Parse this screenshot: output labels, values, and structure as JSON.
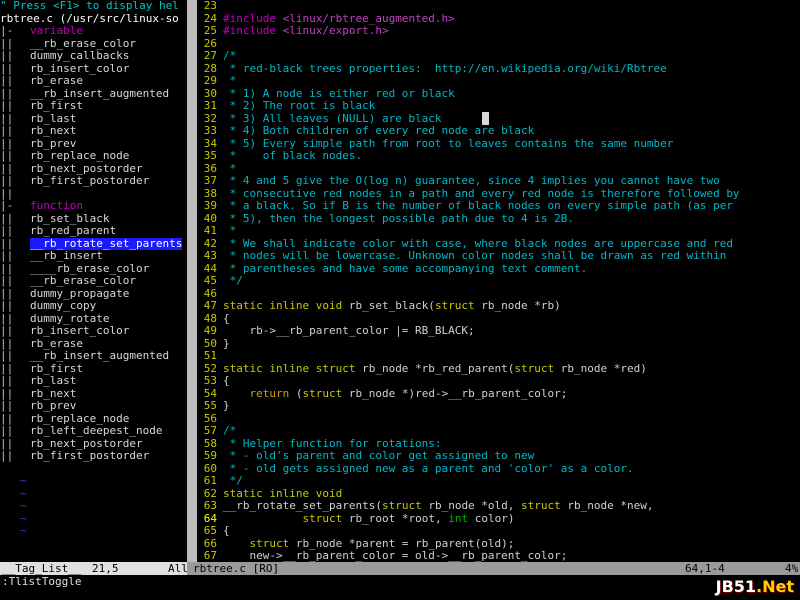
{
  "taglist": {
    "help_line": "\" Press <F1> to display hel",
    "file_line": "rbtree.c (/usr/src/linux-so",
    "groups": [
      {
        "fold": "|-",
        "type": "variable",
        "items": [
          "__rb_erase_color",
          "dummy_callbacks",
          "rb_insert_color",
          "rb_erase",
          "__rb_insert_augmented",
          "rb_first",
          "rb_last",
          "rb_next",
          "rb_prev",
          "rb_replace_node",
          "rb_next_postorder",
          "rb_first_postorder"
        ]
      },
      {
        "fold": "|-",
        "type": "function",
        "items": [
          "rb_set_black",
          "rb_red_parent",
          "__rb_rotate_set_parents",
          "__rb_insert",
          "____rb_erase_color",
          "__rb_erase_color",
          "dummy_propagate",
          "dummy_copy",
          "dummy_rotate",
          "rb_insert_color",
          "rb_erase",
          "__rb_insert_augmented",
          "rb_first",
          "rb_last",
          "rb_next",
          "rb_prev",
          "rb_replace_node",
          "rb_left_deepest_node",
          "rb_next_postorder",
          "rb_first_postorder"
        ]
      }
    ],
    "selected": "__rb_rotate_set_parents",
    "tilde": "~"
  },
  "editor": {
    "lines": [
      {
        "n": "23",
        "segs": [
          {
            "c": "code",
            "t": ""
          }
        ]
      },
      {
        "n": "24",
        "segs": [
          {
            "c": "pp",
            "t": "#include "
          },
          {
            "c": "str",
            "t": "<linux/rbtree_augmented.h>"
          }
        ]
      },
      {
        "n": "25",
        "segs": [
          {
            "c": "pp",
            "t": "#include "
          },
          {
            "c": "str",
            "t": "<linux/export.h>"
          }
        ]
      },
      {
        "n": "26",
        "segs": [
          {
            "c": "code",
            "t": ""
          }
        ]
      },
      {
        "n": "27",
        "segs": [
          {
            "c": "com",
            "t": "/*"
          }
        ]
      },
      {
        "n": "28",
        "segs": [
          {
            "c": "com",
            "t": " * red-black trees properties:  http://en.wikipedia.org/wiki/Rbtree"
          }
        ]
      },
      {
        "n": "29",
        "segs": [
          {
            "c": "com",
            "t": " *"
          }
        ]
      },
      {
        "n": "30",
        "segs": [
          {
            "c": "com",
            "t": " * 1) A node is either red or black"
          }
        ]
      },
      {
        "n": "31",
        "segs": [
          {
            "c": "com",
            "t": " * 2) The root is black"
          }
        ]
      },
      {
        "n": "32",
        "segs": [
          {
            "c": "com",
            "t": " * 3) All leaves (NULL) are black"
          }
        ]
      },
      {
        "n": "33",
        "segs": [
          {
            "c": "com",
            "t": " * 4) Both children of every red node are black"
          }
        ]
      },
      {
        "n": "34",
        "segs": [
          {
            "c": "com",
            "t": " * 5) Every simple path from root to leaves contains the same number"
          }
        ]
      },
      {
        "n": "35",
        "segs": [
          {
            "c": "com",
            "t": " *    of black nodes."
          }
        ]
      },
      {
        "n": "36",
        "segs": [
          {
            "c": "com",
            "t": " *"
          }
        ]
      },
      {
        "n": "37",
        "segs": [
          {
            "c": "com",
            "t": " * 4 and 5 give the O(log n) guarantee, since 4 implies you cannot have two"
          }
        ]
      },
      {
        "n": "38",
        "segs": [
          {
            "c": "com",
            "t": " * consecutive red nodes in a path and every red node is therefore followed by"
          }
        ]
      },
      {
        "n": "39",
        "segs": [
          {
            "c": "com",
            "t": " * a black. So if B is the number of black nodes on every simple path (as per"
          }
        ]
      },
      {
        "n": "40",
        "segs": [
          {
            "c": "com",
            "t": " * 5), then the longest possible path due to 4 is 2B."
          }
        ]
      },
      {
        "n": "41",
        "segs": [
          {
            "c": "com",
            "t": " *"
          }
        ]
      },
      {
        "n": "42",
        "segs": [
          {
            "c": "com",
            "t": " * We shall indicate color with case, where black nodes are uppercase and red"
          }
        ]
      },
      {
        "n": "43",
        "segs": [
          {
            "c": "com",
            "t": " * nodes will be lowercase. Unknown color nodes shall be drawn as red within"
          }
        ]
      },
      {
        "n": "44",
        "segs": [
          {
            "c": "com",
            "t": " * parentheses and have some accompanying text comment."
          }
        ]
      },
      {
        "n": "45",
        "segs": [
          {
            "c": "com",
            "t": " */"
          }
        ]
      },
      {
        "n": "46",
        "segs": [
          {
            "c": "code",
            "t": ""
          }
        ]
      },
      {
        "n": "47",
        "segs": [
          {
            "c": "kw",
            "t": "static inline void"
          },
          {
            "c": "code",
            "t": " rb_set_black("
          },
          {
            "c": "kw",
            "t": "struct"
          },
          {
            "c": "code",
            "t": " rb_node *rb)"
          }
        ]
      },
      {
        "n": "48",
        "segs": [
          {
            "c": "code",
            "t": "{"
          }
        ]
      },
      {
        "n": "49",
        "segs": [
          {
            "c": "code",
            "t": "    rb->__rb_parent_color |= RB_BLACK;"
          }
        ]
      },
      {
        "n": "50",
        "segs": [
          {
            "c": "code",
            "t": "}"
          }
        ]
      },
      {
        "n": "51",
        "segs": [
          {
            "c": "code",
            "t": ""
          }
        ]
      },
      {
        "n": "52",
        "segs": [
          {
            "c": "kw",
            "t": "static inline struct"
          },
          {
            "c": "code",
            "t": " rb_node *rb_red_parent("
          },
          {
            "c": "kw",
            "t": "struct"
          },
          {
            "c": "code",
            "t": " rb_node *red)"
          }
        ]
      },
      {
        "n": "53",
        "segs": [
          {
            "c": "code",
            "t": "{"
          }
        ]
      },
      {
        "n": "54",
        "segs": [
          {
            "c": "code",
            "t": "    "
          },
          {
            "c": "ret",
            "t": "return"
          },
          {
            "c": "code",
            "t": " ("
          },
          {
            "c": "kw",
            "t": "struct"
          },
          {
            "c": "code",
            "t": " rb_node *)red->__rb_parent_color;"
          }
        ]
      },
      {
        "n": "55",
        "segs": [
          {
            "c": "code",
            "t": "}"
          }
        ]
      },
      {
        "n": "56",
        "segs": [
          {
            "c": "code",
            "t": ""
          }
        ]
      },
      {
        "n": "57",
        "segs": [
          {
            "c": "com",
            "t": "/*"
          }
        ]
      },
      {
        "n": "58",
        "segs": [
          {
            "c": "com",
            "t": " * Helper function for rotations:"
          }
        ]
      },
      {
        "n": "59",
        "segs": [
          {
            "c": "com",
            "t": " * - old's parent and color get assigned to new"
          }
        ]
      },
      {
        "n": "60",
        "segs": [
          {
            "c": "com",
            "t": " * - old gets assigned new as a parent and 'color' as a color."
          }
        ]
      },
      {
        "n": "61",
        "segs": [
          {
            "c": "com",
            "t": " */"
          }
        ]
      },
      {
        "n": "62",
        "segs": [
          {
            "c": "kw",
            "t": "static inline void"
          }
        ]
      },
      {
        "n": "63",
        "segs": [
          {
            "c": "code",
            "t": "__rb_rotate_set_parents("
          },
          {
            "c": "kw",
            "t": "struct"
          },
          {
            "c": "code",
            "t": " rb_node *old, "
          },
          {
            "c": "kw",
            "t": "struct"
          },
          {
            "c": "code",
            "t": " rb_node *new,"
          }
        ]
      },
      {
        "n": "64",
        "cur": true,
        "segs": [
          {
            "c": "code",
            "t": "            "
          },
          {
            "c": "kw",
            "t": "struct"
          },
          {
            "c": "code",
            "t": " rb_root *root, "
          },
          {
            "c": "typ",
            "t": "int"
          },
          {
            "c": "code",
            "t": " color)"
          }
        ]
      },
      {
        "n": "65",
        "segs": [
          {
            "c": "code",
            "t": "{"
          }
        ]
      },
      {
        "n": "66",
        "segs": [
          {
            "c": "code",
            "t": "    "
          },
          {
            "c": "kw",
            "t": "struct"
          },
          {
            "c": "code",
            "t": " rb_node *parent = rb_parent(old);"
          }
        ]
      },
      {
        "n": "67",
        "segs": [
          {
            "c": "code",
            "t": "    new->__rb_parent_color = old->__rb_parent_color;"
          }
        ]
      }
    ]
  },
  "status": {
    "left_name": "__Tag_List__",
    "left_pos": "21,5",
    "left_all": "All",
    "file": "rbtree.c [RO]",
    "pos": "64,1-4",
    "pct": "4%"
  },
  "cmdline": ":TlistToggle",
  "watermark": {
    "main": "JB51",
    "accent": ".Net"
  },
  "colors": {
    "comment": "#00b8c8",
    "keyword": "#c8c800",
    "preproc": "#c000c0",
    "selection": "#1a1aff"
  }
}
